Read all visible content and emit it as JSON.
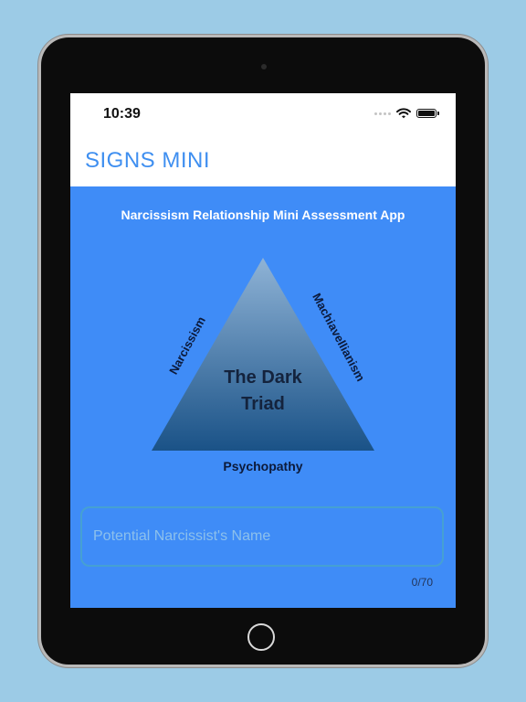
{
  "status_bar": {
    "time": "10:39"
  },
  "header": {
    "title": "SIGNS MINI"
  },
  "main": {
    "subtitle": "Narcissism Relationship Mini Assessment  App",
    "diagram": {
      "center_line_1": "The Dark",
      "center_line_2": "Triad",
      "left_label": "Narcissism",
      "right_label": "Machiavellianism",
      "bottom_label": "Psychopathy"
    },
    "name_input": {
      "placeholder": "Potential Narcissist's Name",
      "value": ""
    },
    "char_counter": "0/70"
  },
  "icons": {
    "signal": "signal-dots-icon",
    "wifi": "wifi-icon",
    "battery": "battery-icon",
    "home": "home-button-icon"
  },
  "colors": {
    "screen_background": "#3f8cf7",
    "title_accent": "#3f8ff0",
    "triangle_top": "#8fb3d6",
    "triangle_bottom": "#1a5287",
    "input_border": "#46a0d2",
    "page_background": "#9ccbe6"
  }
}
